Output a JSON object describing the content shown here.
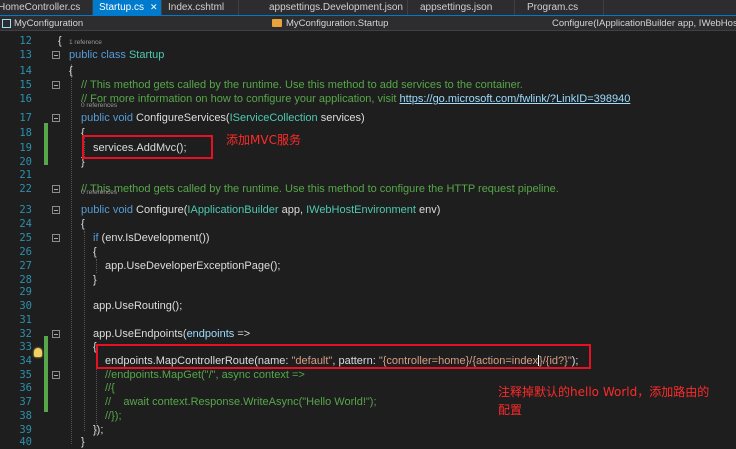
{
  "tabs": [
    {
      "label": "HomeController.cs",
      "active": false
    },
    {
      "label": "Startup.cs",
      "active": true,
      "close": "✕"
    },
    {
      "label": "Index.cshtml",
      "active": false
    },
    {
      "label": "appsettings.Development.json",
      "active": false
    },
    {
      "label": "appsettings.json",
      "active": false
    },
    {
      "label": "Program.cs",
      "active": false
    }
  ],
  "nav": {
    "project": "MyConfiguration",
    "class": "MyConfiguration.Startup",
    "member": "Configure(IApplicationBuilder app, IWebHostEn"
  },
  "lens": {
    "class_refs": "1 reference",
    "configure_services_refs": "0 references",
    "configure_refs": "0 references"
  },
  "code": {
    "l12": "{",
    "l13_kw1": "public",
    "l13_kw2": "class",
    "l13_name": "Startup",
    "l14": "{",
    "l15": "// This method gets called by the runtime. Use this method to add services to the container.",
    "l16_text": "// For more information on how to configure your application, visit ",
    "l16_link": "https://go.microsoft.com/fwlink/?LinkID=398940",
    "l17_kw1": "public",
    "l17_kw2": "void",
    "l17_rest": " ConfigureServices(",
    "l17_type": "IServiceCollection",
    "l17_end": " services)",
    "l18": "{",
    "l19": "services.AddMvc();",
    "l20": "}",
    "l22_prefix": "// ",
    "l22_text": "This method gets called by the runtime. Use this method to configure the HTTP request pipeline.",
    "l23_kw1": "public",
    "l23_kw2": "void",
    "l23_rest": " Configure(",
    "l23_type1": "IApplicationBuilder",
    "l23_mid": " app, ",
    "l23_type2": "IWebHostEnvironment",
    "l23_end": " env)",
    "l24": "{",
    "l25_kw": "if",
    "l25_rest": " (env.IsDevelopment())",
    "l26": "{",
    "l27": "app.UseDeveloperExceptionPage();",
    "l28": "}",
    "l30": "app.UseRouting();",
    "l32_a": "app.UseEndpoints(",
    "l32_b": "endpoints",
    "l32_c": " =>",
    "l33": "{",
    "l34_a": "endpoints.MapControllerRoute(name: ",
    "l34_s1": "\"default\"",
    "l34_b": ", pattern: ",
    "l34_s2a": "\"{controller=home}/{action=index",
    "l34_s2b": "}/{id?}\"",
    "l34_c": ");",
    "l35": "//endpoints.MapGet(\"/\", async context =>",
    "l36": "//{",
    "l37": "//    await context.Response.WriteAsync(\"Hello World!\");",
    "l38": "//});",
    "l39": "});",
    "l40": "}"
  },
  "annotations": {
    "add_mvc": "添加MVC服务",
    "route_line1": "注释掉默认的hello World，添加路由的",
    "route_line2": "配置"
  },
  "colors": {
    "keyword": "#569cd6",
    "type": "#4ec9b0",
    "comment": "#57a64a",
    "string": "#d69d85",
    "annotation": "#ff2a2a",
    "accent": "#007acc"
  }
}
